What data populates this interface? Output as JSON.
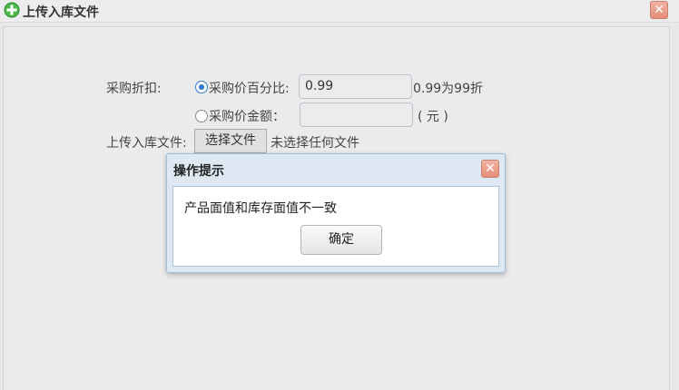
{
  "window": {
    "title": "上传入库文件",
    "close_symbol": "✕",
    "title_icon": "plus-circle-icon",
    "accent_icon_color": "#3aa83a"
  },
  "form": {
    "discount_label": "采购折扣:",
    "option_percent_label": "采购价百分比:",
    "option_percent_selected": true,
    "percent_value": "0.99",
    "percent_hint": "0.99为99折",
    "option_amount_label": "采购价金额：",
    "option_amount_selected": false,
    "amount_value": "",
    "amount_unit": "( 元 )",
    "upload_label": "上传入库文件:",
    "choose_file_button": "选择文件",
    "no_file_text": "未选择任何文件"
  },
  "dialog": {
    "title": "操作提示",
    "close_symbol": "✕",
    "message": "产品面值和库存面值不一致",
    "ok_button": "确定"
  }
}
